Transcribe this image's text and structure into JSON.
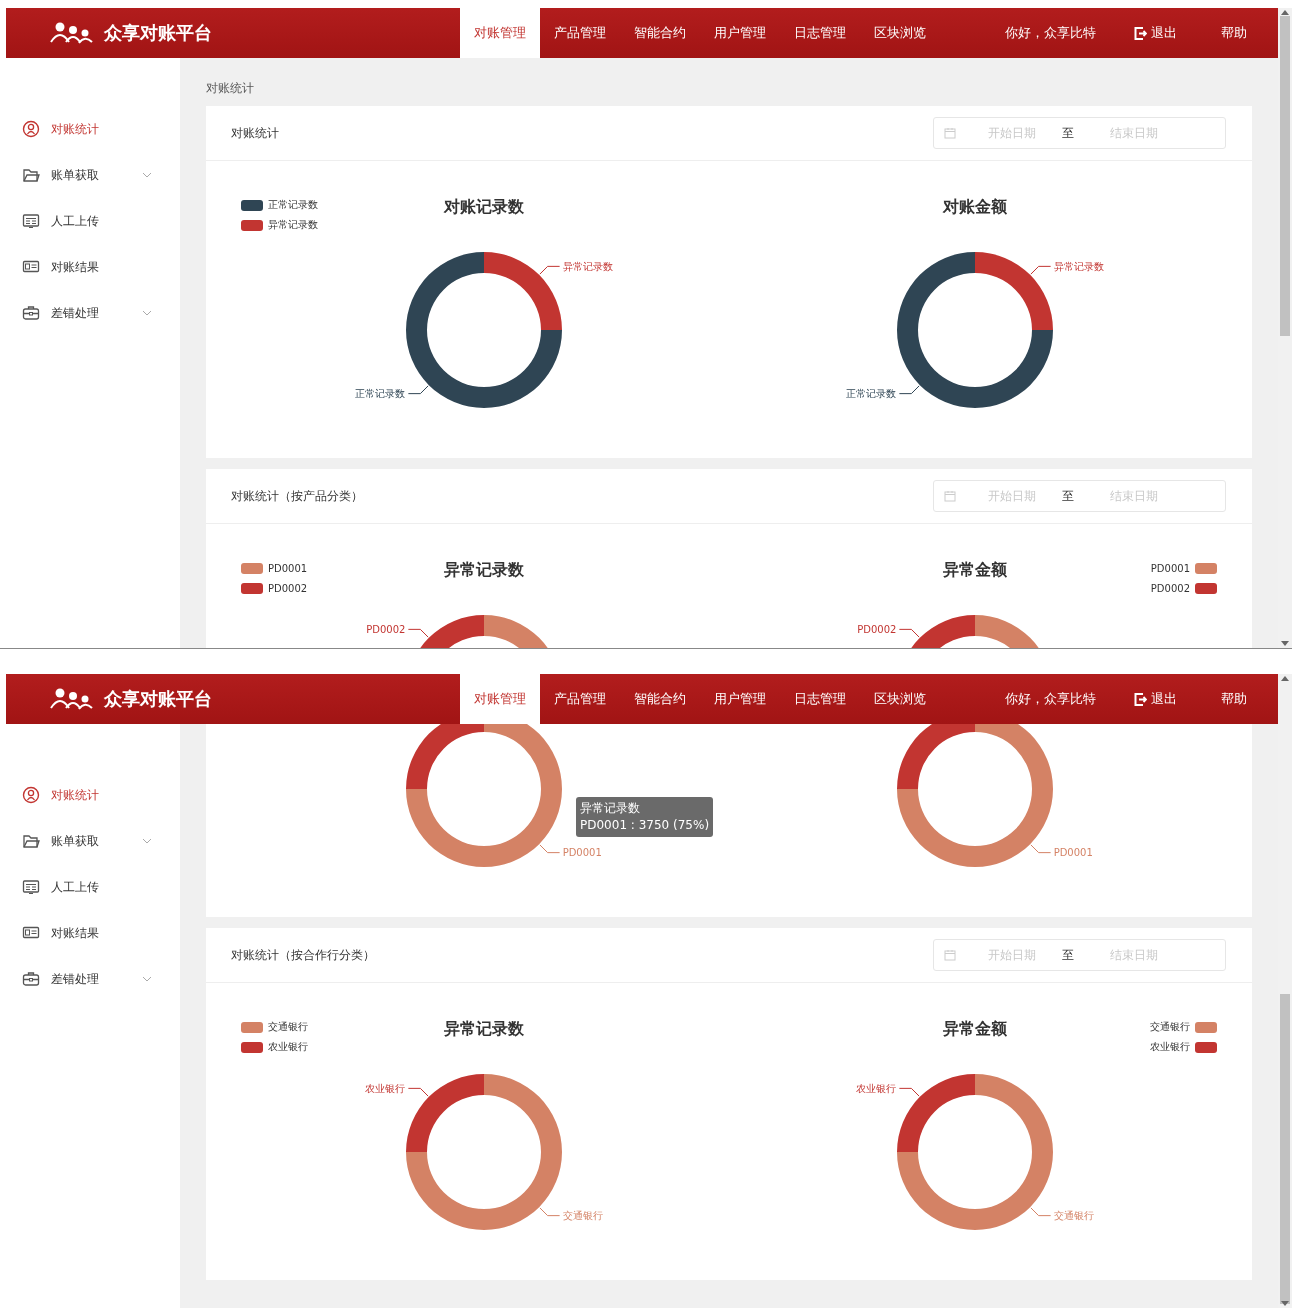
{
  "screens": [
    {
      "header": {
        "brand": "众享对账平台",
        "tabs": [
          {
            "label": "对账管理",
            "selected": true
          },
          {
            "label": "产品管理",
            "selected": false
          },
          {
            "label": "智能合约",
            "selected": false
          },
          {
            "label": "用户管理",
            "selected": false
          },
          {
            "label": "日志管理",
            "selected": false
          },
          {
            "label": "区块浏览",
            "selected": false
          }
        ],
        "greeting": "你好，众享比特",
        "logout": "退出",
        "help": "帮助"
      },
      "sidebar": {
        "items": [
          {
            "label": "对账统计",
            "selected": true
          },
          {
            "label": "账单获取",
            "selected": false,
            "expanded": false
          },
          {
            "label": "人工上传",
            "selected": false
          },
          {
            "label": "对账结果",
            "selected": false
          },
          {
            "label": "差错处理",
            "selected": false,
            "expanded": false
          }
        ]
      },
      "breadcrumb": "对账统计",
      "panels": [
        {
          "title": "对账统计",
          "date_range": {
            "start_placeholder": "开始日期",
            "separator": "至",
            "end_placeholder": "结束日期"
          },
          "legend_left": [
            {
              "label": "正常记录数",
              "color": "#2f4554"
            },
            {
              "label": "异常记录数",
              "color": "#c23531"
            }
          ],
          "charts": [
            {
              "chart_data": {
                "type": "donut",
                "title": "对账记录数",
                "categories": [
                  "异常记录数",
                  "正常记录数"
                ],
                "values": [
                  25,
                  75
                ],
                "colors": [
                  "#c23531",
                  "#2f4554"
                ]
              }
            },
            {
              "chart_data": {
                "type": "donut",
                "title": "对账金额",
                "categories": [
                  "异常记录数",
                  "正常记录数"
                ],
                "values": [
                  25,
                  75
                ],
                "colors": [
                  "#c23531",
                  "#2f4554"
                ]
              }
            }
          ]
        },
        {
          "title": "对账统计（按产品分类）",
          "date_range": {
            "start_placeholder": "开始日期",
            "separator": "至",
            "end_placeholder": "结束日期"
          },
          "legend_left": [
            {
              "label": "PD0001",
              "color": "#d48265"
            },
            {
              "label": "PD0002",
              "color": "#c23531"
            }
          ],
          "legend_right": [
            {
              "label": "PD0001",
              "color": "#d48265"
            },
            {
              "label": "PD0002",
              "color": "#c23531"
            }
          ],
          "charts": [
            {
              "chart_data": {
                "type": "donut",
                "title": "异常记录数",
                "categories": [
                  null,
                  "PD0002"
                ],
                "values": [
                  75,
                  25
                ],
                "colors": [
                  "#d48265",
                  "#c23531"
                ]
              }
            },
            {
              "chart_data": {
                "type": "donut",
                "title": "异常金额",
                "categories": [
                  null,
                  "PD0002"
                ],
                "values": [
                  75,
                  25
                ],
                "colors": [
                  "#d48265",
                  "#c23531"
                ]
              }
            }
          ]
        }
      ]
    },
    {
      "header": {
        "brand": "众享对账平台",
        "tabs": [
          {
            "label": "对账管理",
            "selected": true
          },
          {
            "label": "产品管理",
            "selected": false
          },
          {
            "label": "智能合约",
            "selected": false
          },
          {
            "label": "用户管理",
            "selected": false
          },
          {
            "label": "日志管理",
            "selected": false
          },
          {
            "label": "区块浏览",
            "selected": false
          }
        ],
        "greeting": "你好，众享比特",
        "logout": "退出",
        "help": "帮助"
      },
      "sidebar": {
        "items": [
          {
            "label": "对账统计",
            "selected": true
          },
          {
            "label": "账单获取",
            "selected": false,
            "expanded": false
          },
          {
            "label": "人工上传",
            "selected": false
          },
          {
            "label": "对账结果",
            "selected": false
          },
          {
            "label": "差错处理",
            "selected": false,
            "expanded": false
          }
        ]
      },
      "panels": [
        {
          "charts": [
            {
              "chart_data": {
                "type": "donut",
                "categories": [
                  "PD0001",
                  null
                ],
                "values": [
                  75,
                  25
                ],
                "colors": [
                  "#d48265",
                  "#c23531"
                ]
              },
              "tooltip": {
                "title": "异常记录数",
                "text": "PD0001 : 3750 (75%)"
              }
            },
            {
              "chart_data": {
                "type": "donut",
                "categories": [
                  "PD0001",
                  null
                ],
                "values": [
                  75,
                  25
                ],
                "colors": [
                  "#d48265",
                  "#c23531"
                ]
              }
            }
          ]
        },
        {
          "title": "对账统计（按合作行分类）",
          "date_range": {
            "start_placeholder": "开始日期",
            "separator": "至",
            "end_placeholder": "结束日期"
          },
          "legend_left": [
            {
              "label": "交通银行",
              "color": "#d48265"
            },
            {
              "label": "农业银行",
              "color": "#c23531"
            }
          ],
          "legend_right": [
            {
              "label": "交通银行",
              "color": "#d48265"
            },
            {
              "label": "农业银行",
              "color": "#c23531"
            }
          ],
          "charts": [
            {
              "chart_data": {
                "type": "donut",
                "title": "异常记录数",
                "categories": [
                  "交通银行",
                  "农业银行"
                ],
                "values": [
                  75,
                  25
                ],
                "colors": [
                  "#d48265",
                  "#c23531"
                ]
              }
            },
            {
              "chart_data": {
                "type": "donut",
                "title": "异常金额",
                "categories": [
                  "交通银行",
                  "农业银行"
                ],
                "values": [
                  75,
                  25
                ],
                "colors": [
                  "#d48265",
                  "#c23531"
                ]
              }
            }
          ]
        }
      ]
    }
  ]
}
